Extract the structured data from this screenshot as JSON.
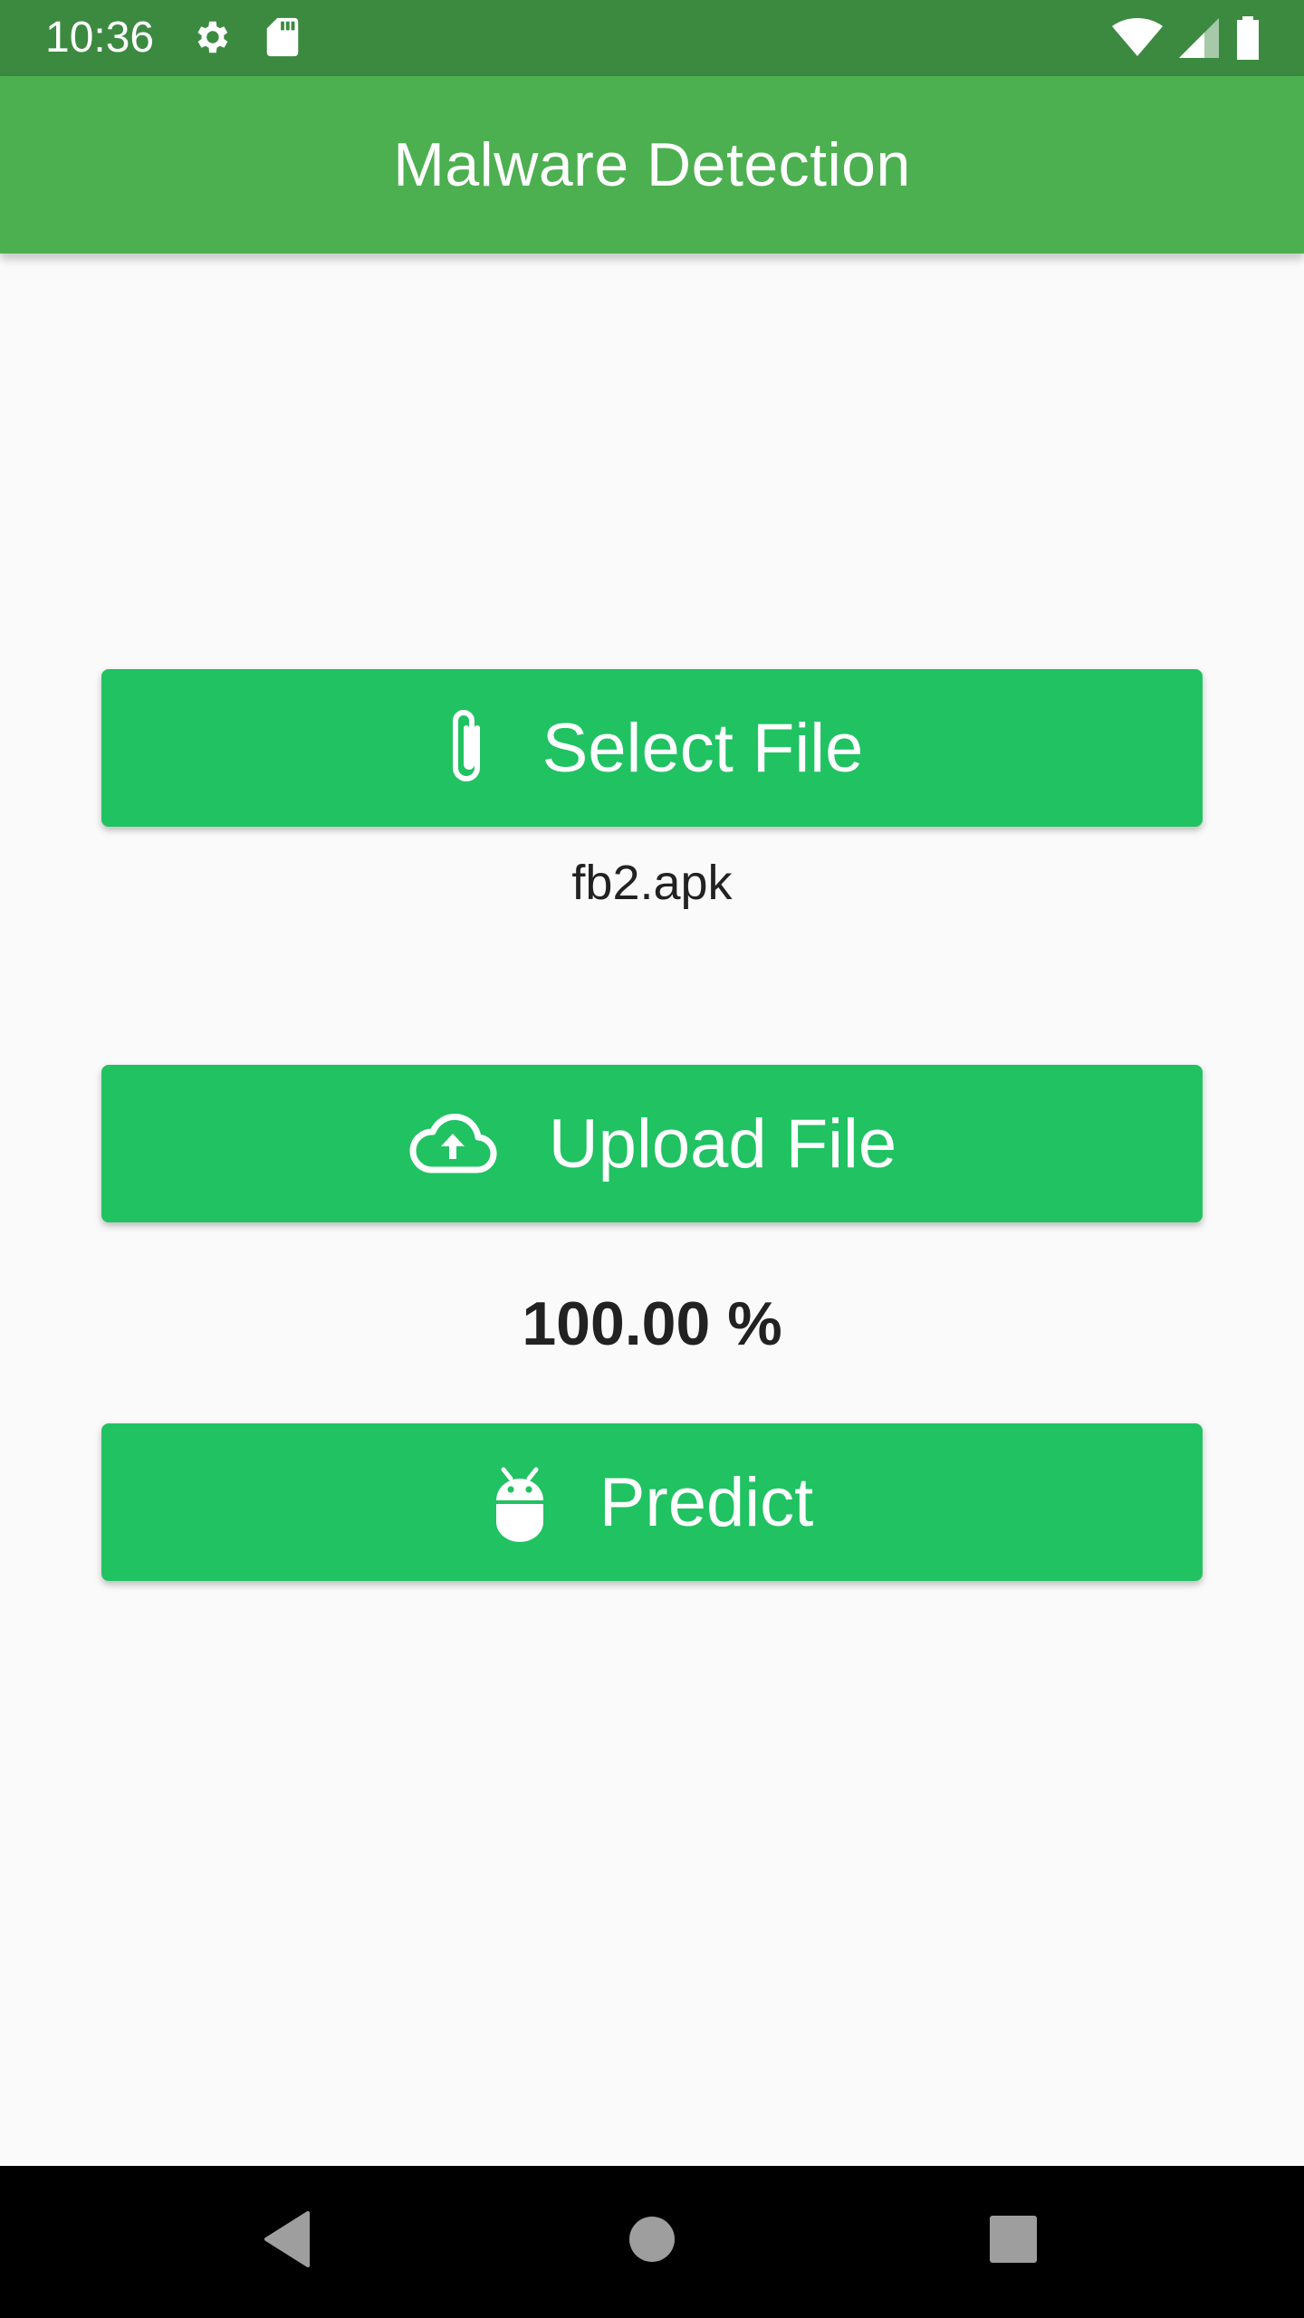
{
  "status_bar": {
    "time": "10:36",
    "icons": [
      "settings-icon",
      "sd-card-icon",
      "wifi-icon",
      "signal-icon",
      "battery-icon"
    ]
  },
  "app_bar": {
    "title": "Malware Detection"
  },
  "buttons": {
    "select_file": {
      "label": "Select File",
      "icon": "paperclip-icon"
    },
    "upload_file": {
      "label": "Upload File",
      "icon": "cloud-upload-icon"
    },
    "predict": {
      "label": "Predict",
      "icon": "android-icon"
    }
  },
  "selected_file": "fb2.apk",
  "upload_progress": "100.00 %",
  "nav_bar": {
    "icons": [
      "back-icon",
      "home-icon",
      "recents-icon"
    ]
  },
  "colors": {
    "status_bar": "#3b8a40",
    "app_bar": "#4caf50",
    "button": "#20c262",
    "background": "#fafafa"
  }
}
